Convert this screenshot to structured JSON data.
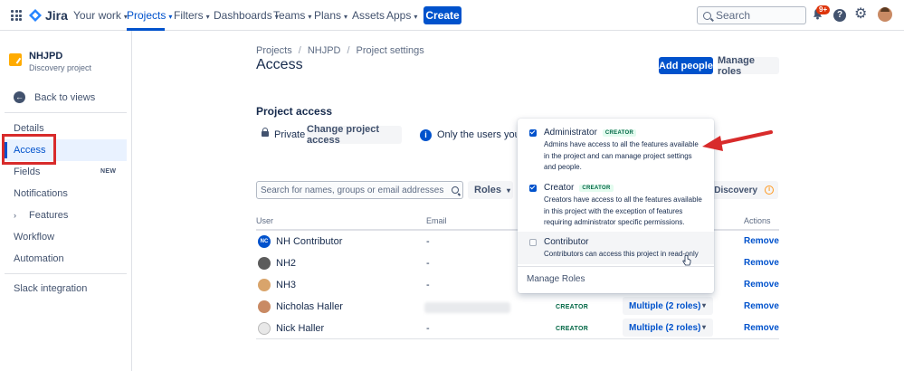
{
  "topnav": {
    "logo": "Jira",
    "items": [
      "Your work",
      "Projects",
      "Filters",
      "Dashboards",
      "Teams",
      "Plans",
      "Assets",
      "Apps"
    ],
    "create_label": "Create",
    "search_placeholder": "Search",
    "notification_count": "9+"
  },
  "sidebar": {
    "project_name": "NHJPD",
    "project_type": "Discovery project",
    "back_label": "Back to views",
    "items": [
      "Details",
      "Access",
      "Fields",
      "Notifications",
      "Features",
      "Workflow",
      "Automation"
    ],
    "fields_badge": "NEW",
    "bottom_item": "Slack integration"
  },
  "breadcrumbs": [
    "Projects",
    "NHJPD",
    "Project settings"
  ],
  "page_title": "Access",
  "actions": {
    "add_people": "Add people",
    "manage_roles": "Manage roles"
  },
  "project_access": {
    "title": "Project access",
    "visibility": "Private",
    "change_label": "Change project access",
    "info_text": "Only the users you spe"
  },
  "filters": {
    "search_placeholder": "Search for names, groups or email addresses",
    "roles_label": "Roles",
    "discovery_text": "ect Discovery"
  },
  "table": {
    "headers": {
      "user": "User",
      "email": "Email",
      "actions": "Actions"
    },
    "rows": [
      {
        "initials": "NC",
        "name": "NH Contributor",
        "email": "-",
        "role": "",
        "role_select": "",
        "action": "Remove"
      },
      {
        "initials": "",
        "name": "NH2",
        "email": "-",
        "role": "",
        "role_select": "",
        "action": "Remove"
      },
      {
        "initials": "",
        "name": "NH3",
        "email": "-",
        "role": "",
        "role_select": "",
        "action": "Remove"
      },
      {
        "initials": "",
        "name": "Nicholas Haller",
        "email": "",
        "role": "CREATOR",
        "role_select": "Multiple (2 roles)",
        "action": "Remove"
      },
      {
        "initials": "",
        "name": "Nick Haller",
        "email": "-",
        "role": "CREATOR",
        "role_select": "Multiple (2 roles)",
        "action": "Remove"
      }
    ]
  },
  "roles_dropdown": {
    "options": [
      {
        "name": "Administrator",
        "badge": "CREATOR",
        "checked": true,
        "desc": "Admins have access to all the features available in the project and can manage project settings and people."
      },
      {
        "name": "Creator",
        "badge": "CREATOR",
        "checked": true,
        "desc": "Creators have access to all the features available in this project with the exception of features requiring administrator specific permissions."
      },
      {
        "name": "Contributor",
        "badge": "",
        "checked": false,
        "desc": "Contributors can access this project in read-only"
      }
    ],
    "manage_label": "Manage Roles"
  },
  "colors": {
    "brand": "#0052cc",
    "annotation": "#d82b2b",
    "creator_badge": "#006644"
  }
}
